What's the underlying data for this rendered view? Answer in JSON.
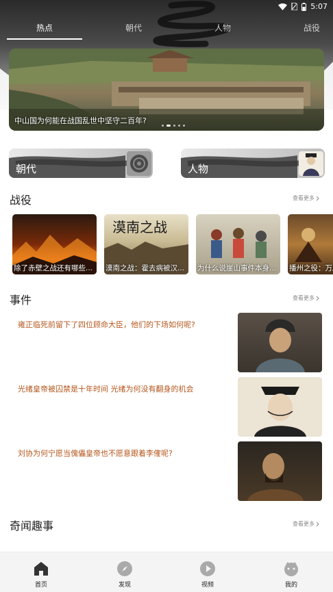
{
  "status_bar": {
    "time": "5:07",
    "icons": [
      "wifi-icon",
      "sim-icon",
      "battery-icon"
    ]
  },
  "tabs": [
    {
      "label": "热点",
      "active": true
    },
    {
      "label": "朝代",
      "active": false
    },
    {
      "label": "人物",
      "active": false
    },
    {
      "label": "战役",
      "active": false
    }
  ],
  "banner": {
    "caption": "中山国为何能在战国乱世中坚守二百年?",
    "dots": 5,
    "active_dot": 1
  },
  "categories": [
    {
      "label": "朝代",
      "thumb": "bronze-artifact-icon"
    },
    {
      "label": "人物",
      "thumb": "portrait-icon"
    }
  ],
  "battles": {
    "title": "战役",
    "more": "查看更多",
    "items": [
      {
        "title": "除了赤壁之战还有哪些..."
      },
      {
        "title": "漠南之战：霍去病被汉..."
      },
      {
        "title": "为什么说崖山事件本身..."
      },
      {
        "title": "播州之役：万历三大征..."
      }
    ]
  },
  "events": {
    "title": "事件",
    "more": "查看更多",
    "items": [
      {
        "title": "雍正临死前留下了四位顾命大臣，他们的下场如何呢?"
      },
      {
        "title": "光绪皇帝被囚禁是十年时间 光绪为何没有翻身的机会"
      },
      {
        "title": "刘协为何宁愿当傀儡皇帝也不愿意跟着李傕呢?"
      }
    ]
  },
  "anecdotes": {
    "title": "奇闻趣事",
    "more": "查看更多"
  },
  "bottom_nav": [
    {
      "label": "首页",
      "icon": "home-icon"
    },
    {
      "label": "发现",
      "icon": "compass-icon"
    },
    {
      "label": "视频",
      "icon": "play-icon"
    },
    {
      "label": "我的",
      "icon": "profile-icon"
    }
  ],
  "colors": {
    "accent_text": "#b4561c",
    "header_dark": "#2a2a2a",
    "nav_bg": "#f4f4f4"
  }
}
